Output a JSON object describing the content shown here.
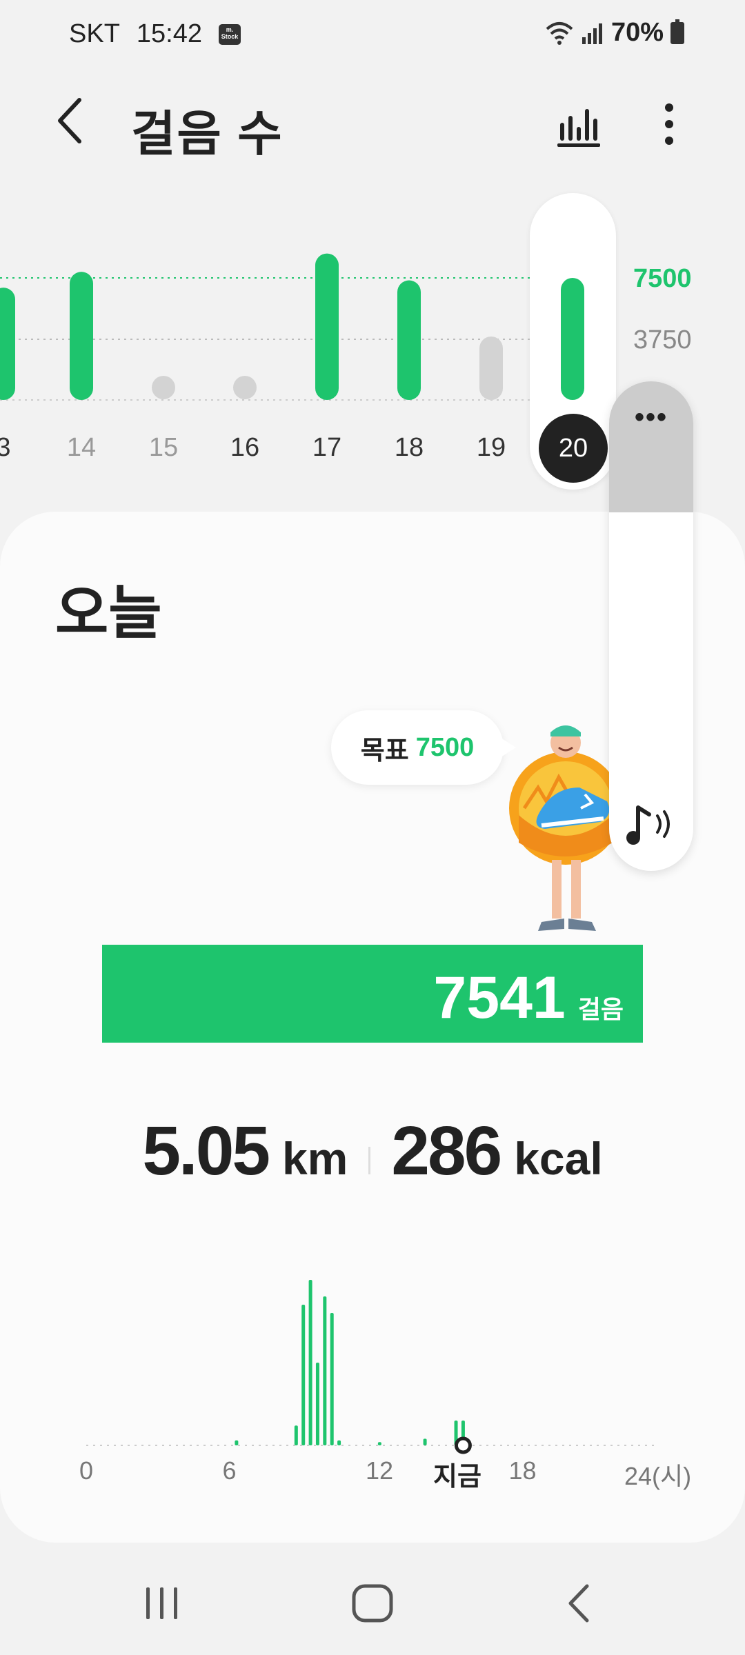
{
  "status_bar": {
    "carrier": "SKT",
    "time": "15:42",
    "stock_badge": "m. Stock",
    "battery": "70%"
  },
  "header": {
    "title": "걸음 수",
    "back_icon": "chevron-left-icon",
    "chart_icon": "bar-chart-icon",
    "more_icon": "more-vertical-icon"
  },
  "weekly_chart": {
    "goal_label": "7500",
    "half_label": "3750",
    "selected_day": "20",
    "days": [
      {
        "label": "3",
        "reached": true,
        "ratio": 0.92
      },
      {
        "label": "14",
        "reached": true,
        "ratio": 1.05
      },
      {
        "label": "15",
        "reached": false,
        "ratio": 0.05
      },
      {
        "label": "16",
        "reached": false,
        "ratio": 0.05
      },
      {
        "label": "17",
        "reached": true,
        "ratio": 1.2
      },
      {
        "label": "18",
        "reached": true,
        "ratio": 0.98
      },
      {
        "label": "19",
        "reached": false,
        "ratio": 0.52
      },
      {
        "label": "20",
        "reached": true,
        "ratio": 1.0
      }
    ]
  },
  "today": {
    "title": "오늘",
    "goal_label": "목표",
    "goal_value": "7500",
    "steps": "7541",
    "steps_unit": "걸음",
    "progress": 1.0,
    "distance": "5.05",
    "distance_unit": "km",
    "calories": "286",
    "calories_unit": "kcal"
  },
  "hourly_chart": {
    "x_labels": [
      "0",
      "6",
      "12",
      "18",
      "24(시)"
    ],
    "now_label": "지금",
    "now_hour": 15.8,
    "bars": [
      {
        "hour": 6.3,
        "value": 0.03
      },
      {
        "hour": 8.8,
        "value": 0.12
      },
      {
        "hour": 9.1,
        "value": 0.85
      },
      {
        "hour": 9.4,
        "value": 1.0
      },
      {
        "hour": 9.7,
        "value": 0.5
      },
      {
        "hour": 10.0,
        "value": 0.9
      },
      {
        "hour": 10.3,
        "value": 0.8
      },
      {
        "hour": 10.6,
        "value": 0.03
      },
      {
        "hour": 12.3,
        "value": 0.02
      },
      {
        "hour": 14.2,
        "value": 0.04
      },
      {
        "hour": 15.5,
        "value": 0.15
      },
      {
        "hour": 15.8,
        "value": 0.15
      }
    ]
  },
  "side_panel": {
    "menu_icon": "more-horizontal-icon",
    "audio_icon": "music-note-sound-icon"
  },
  "colors": {
    "accent": "#1ec46d",
    "inactive": "#d3d3d3",
    "dark": "#222222"
  },
  "navbar": {
    "recent_icon": "recent-apps-icon",
    "home_icon": "home-icon",
    "back_icon": "back-icon"
  }
}
